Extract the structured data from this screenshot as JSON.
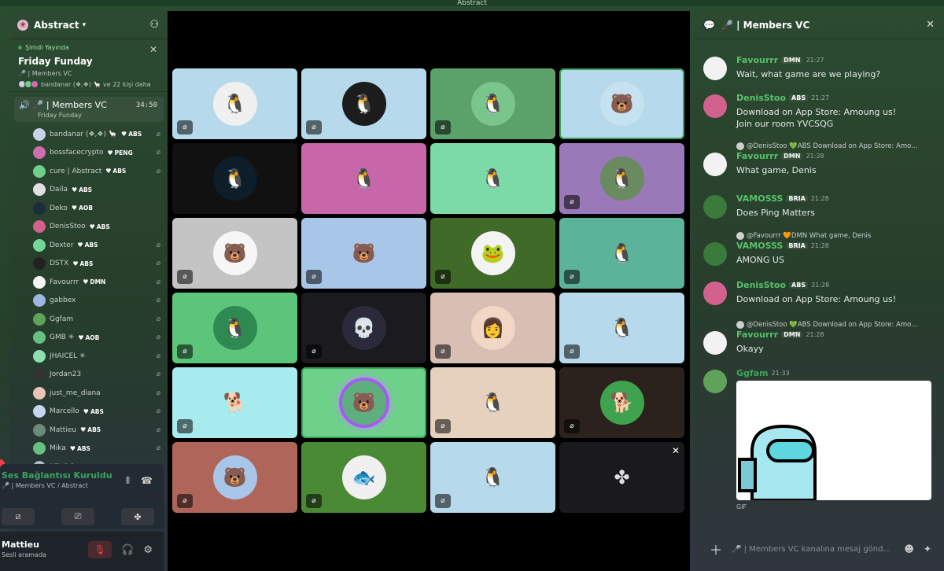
{
  "window": {
    "title": "Abstract"
  },
  "server": {
    "name": "Abstract"
  },
  "live_event": {
    "status": "Şimdi Yayında",
    "title": "Friday Funday",
    "channel": "🎤 | Members VC",
    "attendees": "bandanar (❖,❖) 🦙 ve 22 kişi daha"
  },
  "voice_channel": {
    "name": "🎤 | Members VC",
    "event": "Friday Funday",
    "timer": "34:50"
  },
  "members": [
    {
      "name": "bandanar (❖,❖) 🦙",
      "tag": "ABS",
      "color": "#c9d2e8",
      "muted": true
    },
    {
      "name": "bossfacecrypto",
      "tag": "PENG",
      "color": "#d06db0",
      "muted": true
    },
    {
      "name": "cure | Abstract",
      "tag": "ABS",
      "color": "#6fcf8a",
      "muted": true
    },
    {
      "name": "Daila",
      "tag": "ABS",
      "color": "#e0e0e0",
      "muted": false
    },
    {
      "name": "Deko",
      "tag": "AOB",
      "color": "#1a2d3b",
      "muted": false
    },
    {
      "name": "DenisStoo",
      "tag": "ABS",
      "color": "#d2618d",
      "muted": false
    },
    {
      "name": "Dexter",
      "tag": "ABS",
      "color": "#74d79a",
      "muted": true
    },
    {
      "name": "DSTX",
      "tag": "ABS",
      "color": "#222",
      "muted": true
    },
    {
      "name": "Favourrr",
      "tag": "DMN",
      "color": "#f5f5f5",
      "muted": true
    },
    {
      "name": "gabbex",
      "tag": "",
      "color": "#9fb7e0",
      "muted": true
    },
    {
      "name": "Ggfam",
      "tag": "",
      "color": "#5fa35a",
      "muted": true
    },
    {
      "name": "GMB ✳",
      "tag": "AOB",
      "color": "#66c080",
      "muted": true
    },
    {
      "name": "JHAICEL ✳",
      "tag": "",
      "color": "#8ee0b0",
      "muted": true
    },
    {
      "name": "Jordan23",
      "tag": "",
      "color": "#333",
      "muted": true
    },
    {
      "name": "just_me_diana",
      "tag": "",
      "color": "#e7c4b5",
      "muted": true
    },
    {
      "name": "Marcello",
      "tag": "ABS",
      "color": "#c5d6f0",
      "muted": true
    },
    {
      "name": "Mattieu",
      "tag": "ABS",
      "color": "#6a8a7a",
      "muted": true
    },
    {
      "name": "Mika",
      "tag": "ABS",
      "color": "#66c080",
      "muted": true
    },
    {
      "name": "Nikolai",
      "tag": "ABS",
      "color": "#b0b8c0",
      "muted": true
    }
  ],
  "voice_panel": {
    "status": "Ses Bağlantısı Kuruldu",
    "path": "🎤 | Members VC / Abstract"
  },
  "user": {
    "name": "Mattieu",
    "status": "Sesli aramada"
  },
  "tiles": [
    {
      "bg": "#b6d9eb",
      "av": "#f0f0f0",
      "glyph": "🐧",
      "muted": true
    },
    {
      "bg": "#b6d9eb",
      "av": "#1c1c1c",
      "glyph": "🐧",
      "muted": true
    },
    {
      "bg": "#5aa26a",
      "av": "#79c58a",
      "glyph": "🐧",
      "muted": true
    },
    {
      "bg": "#b6d9eb",
      "av": "#c6e1ef",
      "glyph": "🐻",
      "muted": false,
      "hl": true
    },
    {
      "bg": "#111",
      "av": "#0e1d2a",
      "glyph": "🐧",
      "muted": false
    },
    {
      "bg": "#c766a8",
      "av": "#c766a8",
      "glyph": "🐧",
      "muted": false
    },
    {
      "bg": "#7cd9a8",
      "av": "#7cd9a8",
      "glyph": "🐧",
      "muted": false
    },
    {
      "bg": "#9a79b8",
      "av": "#6a8a60",
      "glyph": "🐧",
      "muted": true
    },
    {
      "bg": "#c4c4c4",
      "av": "#f6f6f6",
      "glyph": "🐻",
      "muted": true
    },
    {
      "bg": "#a8c6e8",
      "av": "#a8c6e8",
      "glyph": "🐻",
      "muted": true
    },
    {
      "bg": "#3f6a28",
      "av": "#f3f3f3",
      "glyph": "🐸",
      "muted": true
    },
    {
      "bg": "#5bb39a",
      "av": "#5bb39a",
      "glyph": "🐧",
      "muted": true
    },
    {
      "bg": "#5dc57a",
      "av": "#2f8a52",
      "glyph": "🐧",
      "muted": true
    },
    {
      "bg": "#1b1b1f",
      "av": "#2a2a3a",
      "glyph": "💀",
      "muted": true
    },
    {
      "bg": "#d8bfb3",
      "av": "#f2d6c6",
      "glyph": "👩",
      "muted": true
    },
    {
      "bg": "#b6d9eb",
      "av": "#b6d9eb",
      "glyph": "🐧",
      "muted": true
    },
    {
      "bg": "#a8ebee",
      "av": "#a8ebee",
      "glyph": "🐕",
      "muted": true
    },
    {
      "bg": "#6dd18a",
      "av": "#5fae7d",
      "glyph": "🐻",
      "muted": false,
      "hl": true,
      "ring": true
    },
    {
      "bg": "#e6d1bf",
      "av": "#e6d1bf",
      "glyph": "🐧",
      "muted": true
    },
    {
      "bg": "#2c221d",
      "av": "#3fa24e",
      "glyph": "🐕",
      "muted": true
    },
    {
      "bg": "#b0655a",
      "av": "#a8c6e8",
      "glyph": "🐻",
      "muted": true
    },
    {
      "bg": "#4a8a35",
      "av": "#f0f0f0",
      "glyph": "🐟",
      "muted": true
    },
    {
      "bg": "#b6d9eb",
      "av": "#b6d9eb",
      "glyph": "🐧",
      "muted": true
    },
    {
      "bg": "#1a1a1d",
      "av": "#1a1a1d",
      "glyph": "✤",
      "muted": false,
      "close": true
    }
  ],
  "chat": {
    "title": "🎤 | Members VC",
    "messages": [
      {
        "name": "Favourrr",
        "color": "#56c26b",
        "tag": "DMN",
        "time": "21:27",
        "text": "Wait, what game are we playing?",
        "av": "#f2f2f2"
      },
      {
        "name": "DenisStoo",
        "color": "#56c26b",
        "tag": "ABS",
        "time": "21:27",
        "text": "Download on App Store: Amoung us!",
        "text2": "Join our room YVCSQG",
        "av": "#d2618d"
      },
      {
        "reply": "@DenisStoo 💚ABS Download on App Store: Amo...",
        "name": "Favourrr",
        "color": "#56c26b",
        "tag": "DMN",
        "time": "21:28",
        "text": "What game, Denis",
        "av": "#f2f2f2"
      },
      {
        "name": "VAMOSSS",
        "color": "#56c26b",
        "tag": "BRIA",
        "time": "21:28",
        "text": "Does Ping Matters",
        "av": "#3a7a3a"
      },
      {
        "reply": "@Favourrr 🧡DMN What game, Denis",
        "name": "VAMOSSS",
        "color": "#56c26b",
        "tag": "BRIA",
        "time": "21:28",
        "text": "AMONG US",
        "av": "#3a7a3a"
      },
      {
        "name": "DenisStoo",
        "color": "#56c26b",
        "tag": "ABS",
        "time": "21:28",
        "text": "Download on App Store: Amoung us!",
        "av": "#d2618d"
      },
      {
        "reply": "@DenisStoo 💚ABS Download on App Store: Amo...",
        "name": "Favourrr",
        "color": "#56c26b",
        "tag": "DMN",
        "time": "21:28",
        "text": "Okayy",
        "av": "#f2f2f2"
      },
      {
        "name": "Ggfam",
        "color": "#3ba55c",
        "tag": "",
        "time": "21:33",
        "text": "",
        "av": "#5fa35a"
      }
    ],
    "gif_label": "GIF",
    "composer_placeholder": "🎤 | Members VC kanalına mesaj gönd..."
  }
}
